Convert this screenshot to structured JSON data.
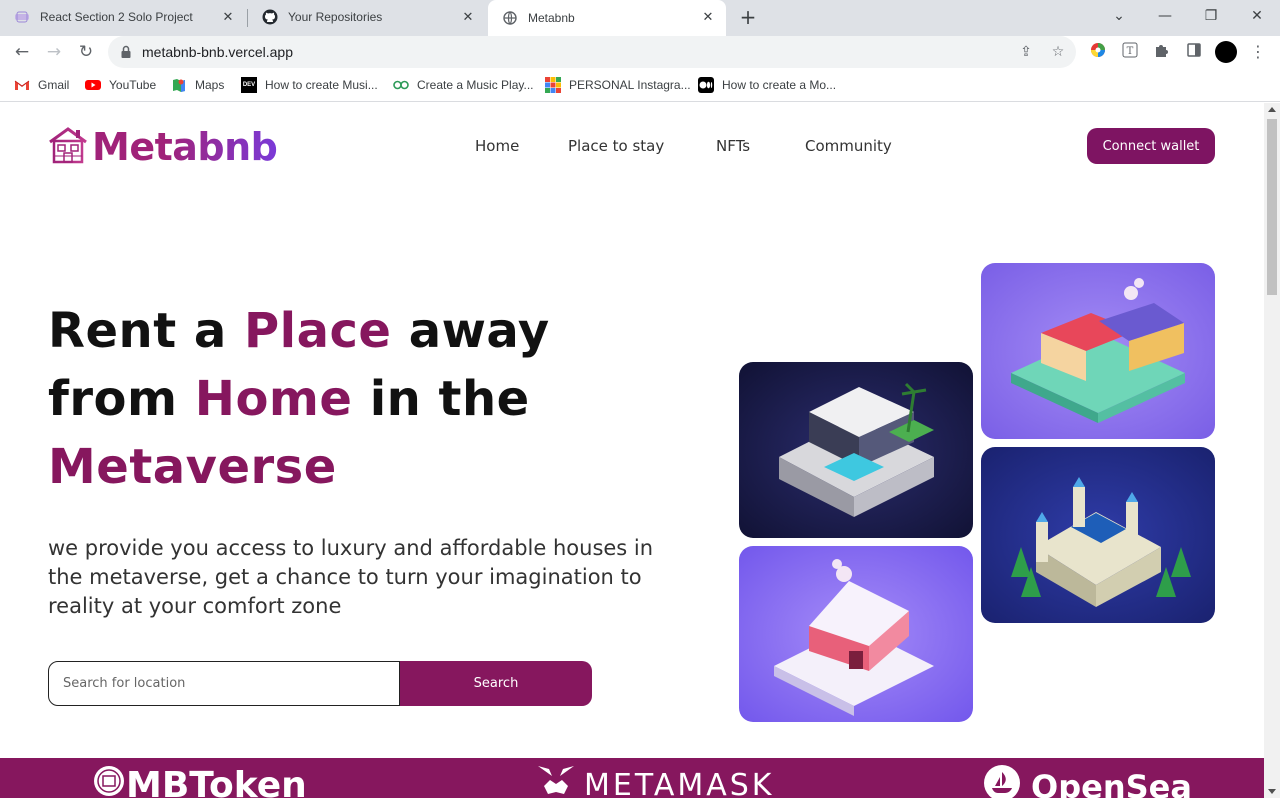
{
  "browser": {
    "tabs": [
      {
        "title": "React Section 2 Solo Project",
        "icon": "react-favicon-icon"
      },
      {
        "title": "Your Repositories",
        "icon": "github-icon"
      },
      {
        "title": "Metabnb",
        "icon": "globe-icon"
      }
    ],
    "url": "metabnb-bnb.vercel.app",
    "bookmarks": [
      {
        "label": "Gmail",
        "icon": "gmail-icon"
      },
      {
        "label": "YouTube",
        "icon": "youtube-icon"
      },
      {
        "label": "Maps",
        "icon": "maps-icon"
      },
      {
        "label": "How to create Musi...",
        "icon": "dev-icon"
      },
      {
        "label": "Create a Music Play...",
        "icon": "codepen-icon"
      },
      {
        "label": "PERSONAL Instagra...",
        "icon": "grid-icon"
      },
      {
        "label": "How to create a Mo...",
        "icon": "medium-icon"
      }
    ]
  },
  "site": {
    "brand": "Metabnb",
    "nav": [
      "Home",
      "Place to stay",
      "NFTs",
      "Community"
    ],
    "connect_label": "Connect wallet",
    "hero": {
      "line1_a": "Rent a ",
      "line1_b": "Place",
      "line1_c": " away",
      "line2_a": "from ",
      "line2_b": "Home",
      "line2_c": " in the",
      "line3": "Metaverse",
      "subtitle": "we provide you access to luxury and affordable houses in the metaverse, get a chance to turn your imagination to reality at your comfort zone"
    },
    "search": {
      "placeholder": "Search for location",
      "button": "Search"
    },
    "partners": [
      "MBToken",
      "METAMASK",
      "OpenSea"
    ],
    "colors": {
      "primary": "#A02279",
      "button": "#86175E",
      "partner_bar": "#86175E"
    }
  }
}
